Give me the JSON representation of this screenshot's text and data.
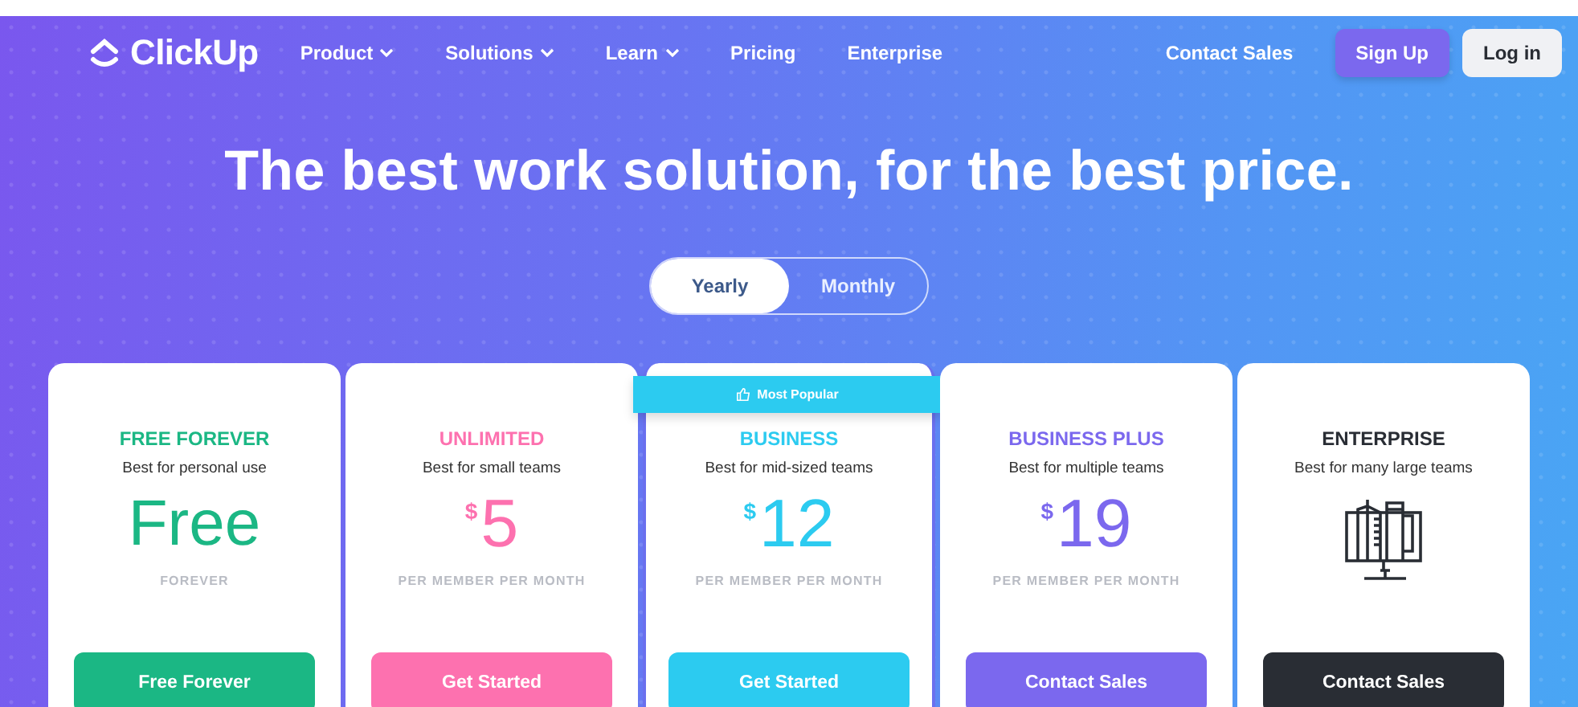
{
  "brand": {
    "name": "ClickUp"
  },
  "nav": [
    {
      "label": "Product",
      "dropdown": true
    },
    {
      "label": "Solutions",
      "dropdown": true
    },
    {
      "label": "Learn",
      "dropdown": true
    },
    {
      "label": "Pricing",
      "dropdown": false
    },
    {
      "label": "Enterprise",
      "dropdown": false
    }
  ],
  "actions": [
    {
      "label": "Contact Sales",
      "kind": "link"
    },
    {
      "label": "Sign Up",
      "kind": "primary"
    },
    {
      "label": "Log in",
      "kind": "secondary"
    }
  ],
  "headline": "The best work solution, for the best price.",
  "billing_toggle": [
    {
      "label": "Yearly",
      "selected": true
    },
    {
      "label": "Monthly",
      "selected": false
    }
  ],
  "plans": [
    {
      "name": "FREE FOREVER",
      "tagline": "Best for personal use",
      "kind": "text",
      "price": "Free",
      "note": "FOREVER",
      "button": "Free Forever",
      "color": "#1bb784",
      "featured": false
    },
    {
      "name": "UNLIMITED",
      "tagline": "Best for small teams",
      "kind": "amount",
      "currency": "$",
      "price": "5",
      "note": "PER MEMBER PER MONTH",
      "button": "Get Started",
      "color": "#fd71af",
      "featured": false
    },
    {
      "name": "BUSINESS",
      "tagline": "Best for mid-sized teams",
      "kind": "amount",
      "currency": "$",
      "price": "12",
      "note": "PER MEMBER PER MONTH",
      "button": "Get Started",
      "color": "#2ccbf0",
      "featured": true,
      "badge": "Most Popular"
    },
    {
      "name": "BUSINESS PLUS",
      "tagline": "Best for multiple teams",
      "kind": "amount",
      "currency": "$",
      "price": "19",
      "note": "PER MEMBER PER MONTH",
      "button": "Contact Sales",
      "color": "#7b68ee",
      "featured": false
    },
    {
      "name": "ENTERPRISE",
      "tagline": "Best for many large teams",
      "kind": "icon",
      "button": "Contact Sales",
      "color": "#292d34",
      "featured": false
    }
  ]
}
